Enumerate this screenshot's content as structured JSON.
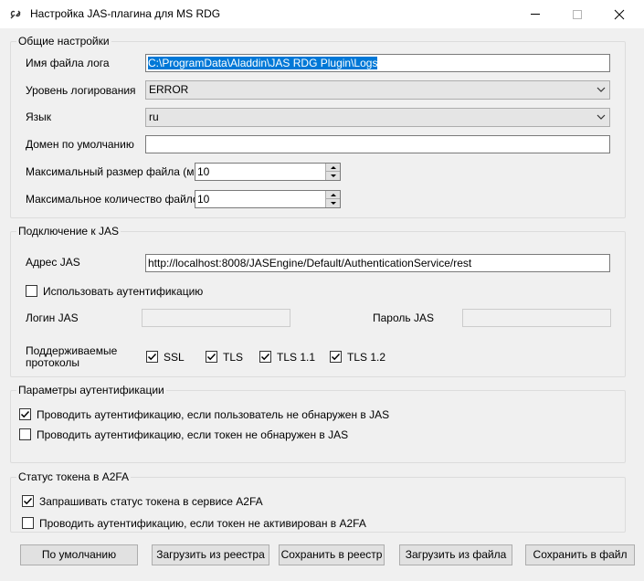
{
  "window": {
    "title": "Настройка JAS-плагина для MS RDG"
  },
  "general": {
    "legend": "Общие настройки",
    "log_file_label": "Имя файла лога",
    "log_file_value": "C:\\ProgramData\\Aladdin\\JAS RDG Plugin\\Logs",
    "log_level_label": "Уровень логирования",
    "log_level_value": "ERROR",
    "language_label": "Язык",
    "language_value": "ru",
    "default_domain_label": "Домен по умолчанию",
    "default_domain_value": "",
    "max_file_size_label": "Максимальный размер файла (мб)",
    "max_file_size_value": "10",
    "max_files_label": "Максимальное количество файлов",
    "max_files_value": "10"
  },
  "jas": {
    "legend": "Подключение к JAS",
    "address_label": "Адрес JAS",
    "address_value": "http://localhost:8008/JASEngine/Default/AuthenticationService/rest",
    "use_auth_label": "Использовать аутентификацию",
    "use_auth_checked": false,
    "login_label": "Логин JAS",
    "login_value": "",
    "password_label": "Пароль JAS",
    "password_value": "",
    "protocols_label_line1": "Поддерживаемые",
    "protocols_label_line2": "протоколы",
    "protocols": [
      {
        "label": "SSL",
        "checked": true
      },
      {
        "label": "TLS",
        "checked": true
      },
      {
        "label": "TLS 1.1",
        "checked": true
      },
      {
        "label": "TLS 1.2",
        "checked": true
      }
    ]
  },
  "auth_params": {
    "legend": "Параметры аутентификации",
    "options": [
      {
        "label": "Проводить аутентификацию, если пользователь не обнаружен в JAS",
        "checked": true
      },
      {
        "label": "Проводить аутентификацию, если токен не обнаружен в JAS",
        "checked": false
      }
    ]
  },
  "token_status": {
    "legend": "Статус токена в A2FA",
    "options": [
      {
        "label": "Запрашивать статус токена в сервисе A2FA",
        "checked": true
      },
      {
        "label": "Проводить аутентификацию, если токен не активирован в A2FA",
        "checked": false
      }
    ]
  },
  "buttons": {
    "defaults": "По умолчанию",
    "load_registry": "Загрузить из реестра",
    "save_registry": "Сохранить в реестр",
    "load_file": "Загрузить из файла",
    "save_file": "Сохранить в файл"
  }
}
